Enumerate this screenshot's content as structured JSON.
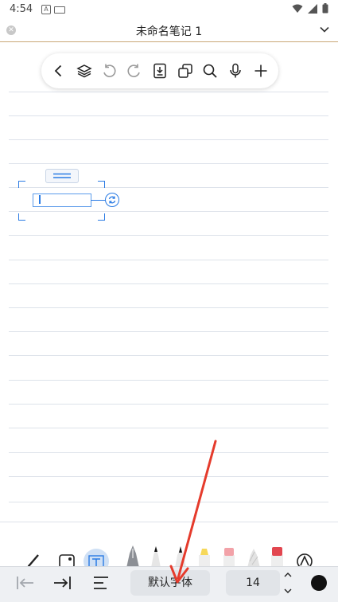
{
  "status_bar": {
    "time": "4:54",
    "indicator_a": "A"
  },
  "title_bar": {
    "title": "未命名笔记 1"
  },
  "floating_toolbar": {
    "icons": [
      "back-icon",
      "layers-icon",
      "undo-icon",
      "redo-icon",
      "page-icon",
      "duplicate-icon",
      "search-icon",
      "microphone-icon",
      "add-icon"
    ]
  },
  "bottom_toolbar": {
    "font_name": "默认字体",
    "font_size": "14",
    "text_color": "#111111"
  },
  "pen_tray": {
    "tools": [
      "pen-icon",
      "image-icon",
      "text-tool-icon",
      "fountain-pen-icon",
      "marker-black-icon",
      "brush-black-icon",
      "highlighter-yellow-icon",
      "highlighter-pink-icon",
      "pencil-texture-icon",
      "eraser-red-icon",
      "lasso-icon"
    ]
  },
  "colors": {
    "accent": "#2a7be4",
    "annotation_arrow": "#e53b2c",
    "title_underline": "#c9a777"
  }
}
